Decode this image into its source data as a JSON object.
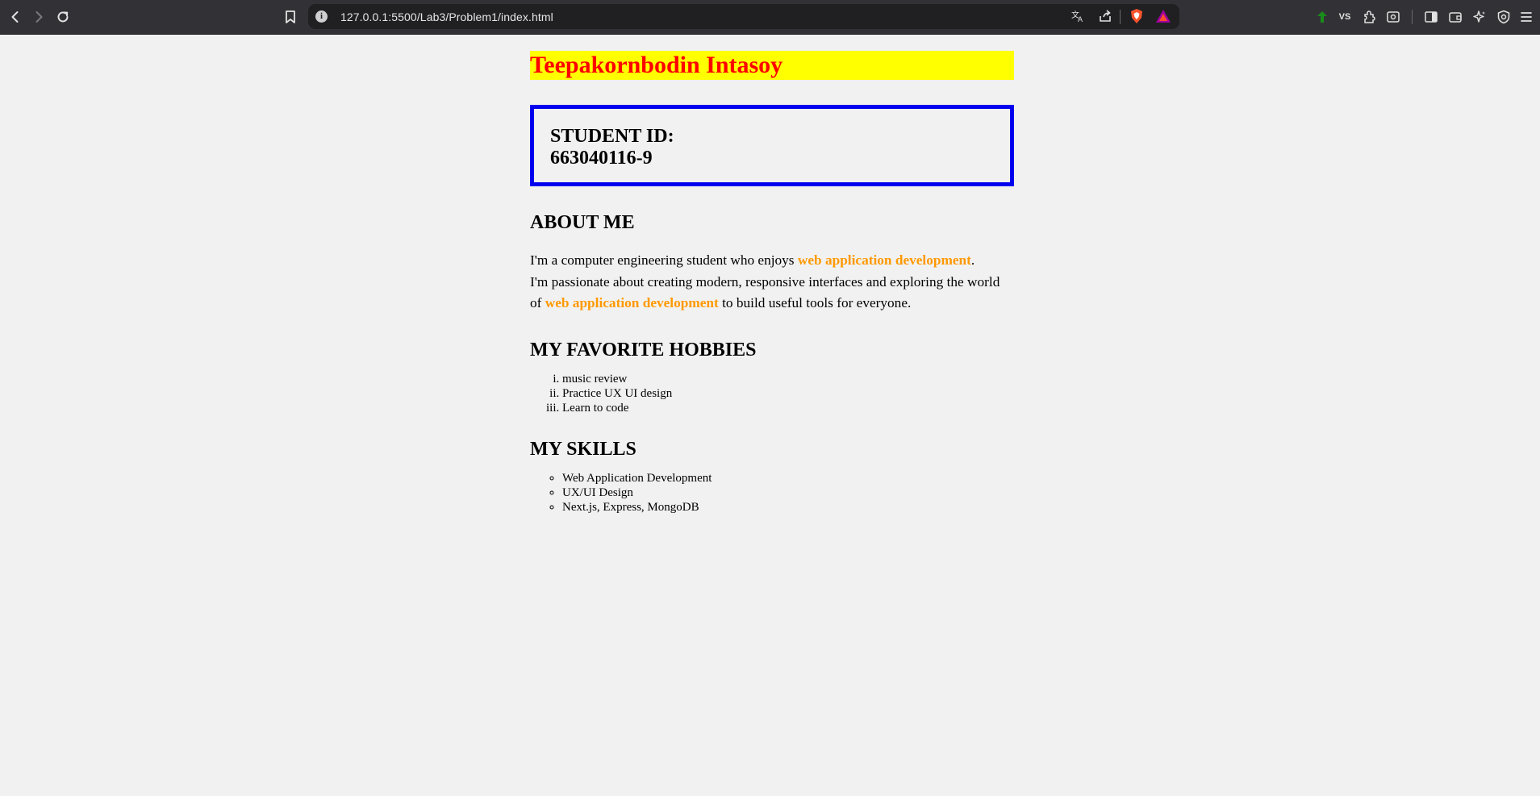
{
  "browser": {
    "url": "127.0.0.1:5500/Lab3/Problem1/index.html",
    "info_glyph": "i",
    "icons": [
      "back-icon",
      "forward-icon",
      "reload-icon",
      "bookmark-icon",
      "translate-icon",
      "share-icon",
      "brave-shields-icon",
      "brave-rewards-icon",
      "extension-green-icon",
      "vs-extension-icon",
      "extensions-icon",
      "reader-icon",
      "sidebar-icon",
      "wallet-icon",
      "leo-icon",
      "vpn-icon",
      "menu-icon"
    ],
    "vs_label": "VS"
  },
  "page": {
    "name": "Teepakornbodin Intasoy",
    "student_id_label": "STUDENT ID:",
    "student_id_value": "663040116-9",
    "about": {
      "title": "ABOUT ME",
      "line1_prefix": "I'm a computer engineering student who enjoys ",
      "highlight1": "web application development",
      "line1_suffix": ".",
      "line2_prefix": "I'm passionate about creating modern, responsive interfaces and exploring the world of ",
      "highlight2": "web application development",
      "line2_suffix": " to build useful tools for everyone."
    },
    "hobbies": {
      "title": "MY FAVORITE HOBBIES",
      "items": [
        "music review",
        "Practice UX UI design",
        "Learn to code"
      ]
    },
    "skills": {
      "title": "MY SKILLS",
      "items": [
        "Web Application Development",
        "UX/UI Design",
        "Next.js, Express, MongoDB"
      ]
    }
  },
  "colors": {
    "name_bg": "#ffff00",
    "name_text": "#ff0000",
    "box_border": "#0000ee",
    "highlight": "#ff9900"
  }
}
